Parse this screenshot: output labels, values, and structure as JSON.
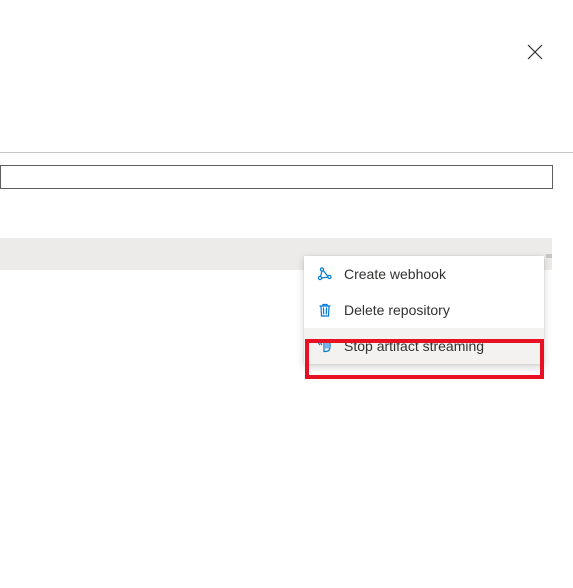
{
  "menu": {
    "items": [
      {
        "id": "create-webhook",
        "label": "Create webhook",
        "icon": "webhook-icon"
      },
      {
        "id": "delete-repository",
        "label": "Delete repository",
        "icon": "trash-icon"
      },
      {
        "id": "stop-artifact-streaming",
        "label": "Stop artifact streaming",
        "icon": "stop-stream-icon"
      }
    ]
  },
  "highlighted_item_index": 2,
  "colors": {
    "accent": "#0078d4",
    "highlight_border": "#e81123"
  }
}
